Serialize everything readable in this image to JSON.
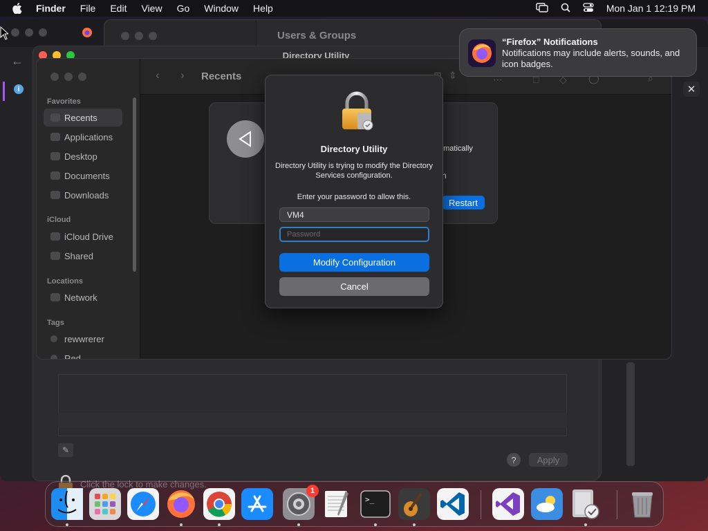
{
  "menubar": {
    "app_name": "Finder",
    "items": [
      "File",
      "Edit",
      "View",
      "Go",
      "Window",
      "Help"
    ],
    "clock": "Mon Jan 1  12:19 PM"
  },
  "users_groups": {
    "title": "Users & Groups",
    "lock_label": "Click the lock to make changes.",
    "help_label": "?",
    "apply_label": "Apply"
  },
  "directory_utility": {
    "title": "Directory Utility"
  },
  "finder": {
    "title": "Recents",
    "sidebar": {
      "favorites_header": "Favorites",
      "favorites": [
        "Recents",
        "Applications",
        "Desktop",
        "Documents",
        "Downloads"
      ],
      "icloud_header": "iCloud",
      "icloud": [
        "iCloud Drive",
        "Shared"
      ],
      "locations_header": "Locations",
      "locations": [
        "Network"
      ],
      "tags_header": "Tags",
      "tags": [
        "rewwrerer",
        "Red"
      ]
    }
  },
  "restart_panel": {
    "text_partial_1": "omatically",
    "text_partial_2": "n",
    "restart_label": "Restart"
  },
  "auth_dialog": {
    "title": "Directory Utility",
    "message": "Directory Utility is trying to modify the Directory Services configuration.",
    "prompt": "Enter your password to allow this.",
    "username_value": "VM4",
    "password_placeholder": "Password",
    "primary_label": "Modify Configuration",
    "cancel_label": "Cancel"
  },
  "notification": {
    "title": "“Firefox” Notifications",
    "body": "Notifications may include alerts, sounds, and icon badges."
  },
  "info_badge": "i",
  "close_button": "✕",
  "dock": {
    "items": [
      {
        "name": "finder",
        "running": true
      },
      {
        "name": "launchpad",
        "running": false
      },
      {
        "name": "safari",
        "running": false
      },
      {
        "name": "firefox",
        "running": true
      },
      {
        "name": "chrome",
        "running": true
      },
      {
        "name": "app-store",
        "running": false
      },
      {
        "name": "system-settings",
        "running": true,
        "badge": "1"
      },
      {
        "name": "textedit",
        "running": false
      },
      {
        "name": "terminal",
        "running": true
      },
      {
        "name": "garageband",
        "running": true
      },
      {
        "name": "vscode",
        "running": false
      },
      {
        "name": "visual-studio",
        "running": false
      },
      {
        "name": "weather",
        "running": false
      },
      {
        "name": "directory-utility",
        "running": true
      },
      {
        "name": "trash",
        "running": false
      }
    ]
  },
  "colors": {
    "accent_blue": "#0a6fe0",
    "focus_ring": "#2f80c8",
    "badge_red": "#ff3b30"
  }
}
